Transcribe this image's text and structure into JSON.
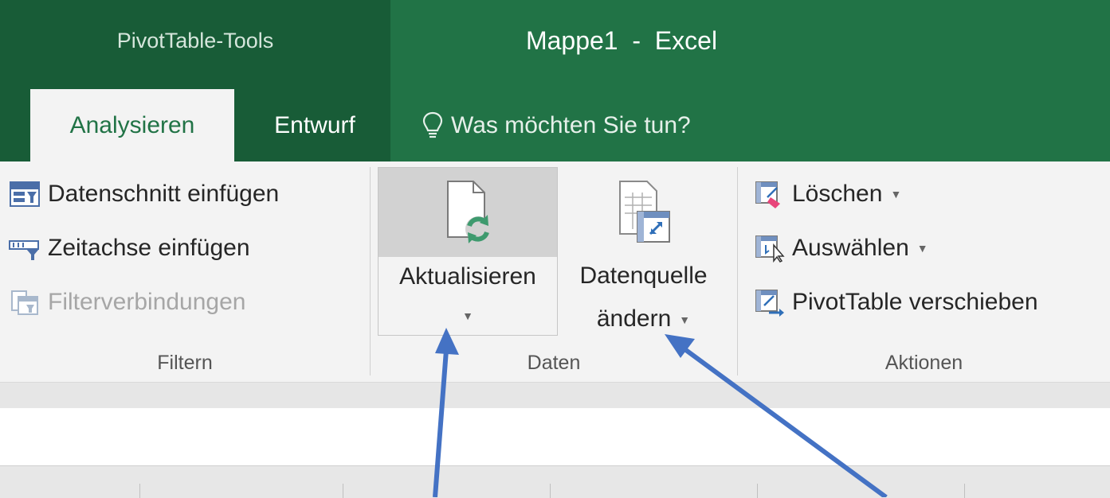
{
  "titlebar": {
    "context_title": "PivotTable-Tools",
    "window_title": "Mappe1  -  Excel"
  },
  "tabs": [
    {
      "label": "Analysieren",
      "active": true
    },
    {
      "label": "Entwurf",
      "active": false
    }
  ],
  "tell_me": {
    "icon": "lightbulb-icon",
    "text": "Was möchten Sie tun?"
  },
  "ribbon": {
    "filtern": {
      "label": "Filtern",
      "items": [
        {
          "label": "Datenschnitt einfügen",
          "icon": "slicer-icon",
          "enabled": true
        },
        {
          "label": "Zeitachse einfügen",
          "icon": "timeline-icon",
          "enabled": true
        },
        {
          "label": "Filterverbindungen",
          "icon": "filter-connections-icon",
          "enabled": false
        }
      ]
    },
    "daten": {
      "label": "Daten",
      "aktualisieren": {
        "label": "Aktualisieren",
        "icon": "refresh-document-icon",
        "has_dropdown": true
      },
      "datenquelle": {
        "label_line1": "Datenquelle",
        "label_line2": "ändern",
        "icon": "change-data-source-icon",
        "has_dropdown": true
      }
    },
    "aktionen": {
      "label": "Aktionen",
      "items": [
        {
          "label": "Löschen",
          "icon": "clear-icon",
          "has_dropdown": true
        },
        {
          "label": "Auswählen",
          "icon": "select-icon",
          "has_dropdown": true
        },
        {
          "label": "PivotTable verschieben",
          "icon": "move-pivottable-icon",
          "has_dropdown": false
        }
      ]
    }
  },
  "colors": {
    "titlebar": "#217346",
    "context_header": "#185c37",
    "ribbon_bg": "#f3f3f3",
    "annotation_arrow": "#4472c4"
  }
}
